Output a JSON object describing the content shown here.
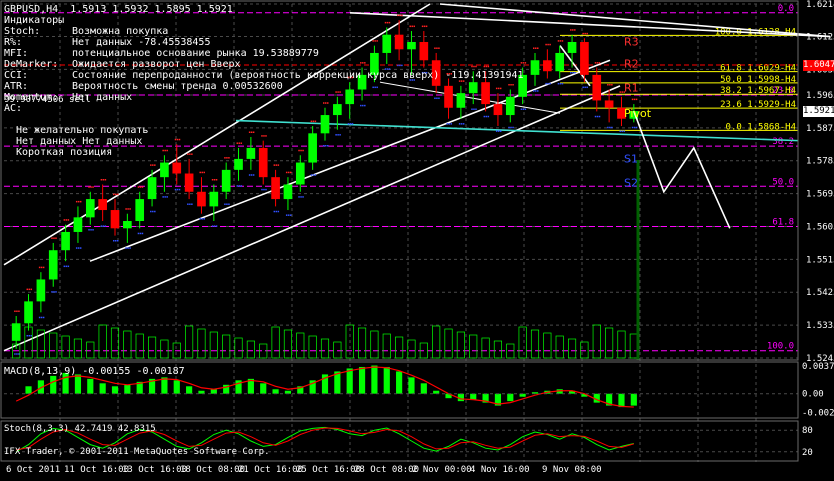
{
  "header": {
    "symbol": "GBPUSD,H4",
    "ohlc": "1.5913 1.5932 1.5895 1.5921"
  },
  "indicators_panel": {
    "title": "Индикаторы",
    "rows": [
      {
        "label": "Stoch:",
        "value": "Возможна покупка"
      },
      {
        "label": "R%:",
        "value": "Нет данных -78.45538455"
      },
      {
        "label": "MFI:",
        "value": "потенциальное основание рынка 19.53889779"
      },
      {
        "label": "DeMarker:",
        "value": "Ожидается разворот цен Вверх"
      },
      {
        "label": "CCI:",
        "value": "Состояние перепроданности (вероятность коррекции курса вверх) -119.41391941"
      },
      {
        "label": "ATR:",
        "value": "Вероятность смены тренда 0.00532600"
      },
      {
        "label": "Momentum:",
        "value": "Нет данных"
      },
      {
        "label": "AC:",
        "value": ""
      }
    ],
    "overlap_text": "99.90774506 sell",
    "signals": [
      "Не желательно покупать",
      "Нет данных Нет данных",
      "Короткая позиция"
    ]
  },
  "colors": {
    "bull": "#00ff00",
    "bear": "#ff0000",
    "grid": "#4a4a4a",
    "fib": "#ff00ff",
    "trend": "#ffffff",
    "cyan": "#40e0d0",
    "dots_red": "#ff2020",
    "dots_blue": "#3050ff",
    "pivot": "#ffff00",
    "macd_signal": "#ff0000",
    "stoch_k": "#00ff00",
    "stoch_d": "#ff0000"
  },
  "chart_data": [
    {
      "type": "candlestick",
      "price_axis": [
        "1.6214",
        "1.6125",
        "1.6035",
        "1.5965",
        "1.5875",
        "1.5785",
        "1.5695",
        "1.5605",
        "1.5515",
        "1.5425",
        "1.5335",
        "1.5245"
      ],
      "ylim": [
        1.5245,
        1.6214
      ],
      "current_price": "1.5921",
      "pivot_price": "1.6047",
      "time_axis": [
        "6 Oct 2011",
        "11 Oct 16:00",
        "13 Oct 16:00",
        "18 Oct 08:00",
        "21 Oct 16:00",
        "25 Oct 16:00",
        "28 Oct 08:00",
        "2 Nov 00:00",
        "4 Nov 16:00",
        "9 Nov 08:00"
      ],
      "candles": [
        [
          1.5292,
          1.536,
          1.527,
          1.534
        ],
        [
          1.534,
          1.542,
          1.532,
          1.54
        ],
        [
          1.54,
          1.548,
          1.537,
          1.546
        ],
        [
          1.546,
          1.556,
          1.544,
          1.554
        ],
        [
          1.554,
          1.561,
          1.551,
          1.559
        ],
        [
          1.559,
          1.566,
          1.556,
          1.563
        ],
        [
          1.563,
          1.57,
          1.561,
          1.568
        ],
        [
          1.568,
          1.572,
          1.562,
          1.565
        ],
        [
          1.565,
          1.568,
          1.558,
          1.56
        ],
        [
          1.56,
          1.564,
          1.556,
          1.562
        ],
        [
          1.562,
          1.57,
          1.56,
          1.568
        ],
        [
          1.568,
          1.576,
          1.566,
          1.574
        ],
        [
          1.574,
          1.58,
          1.57,
          1.578
        ],
        [
          1.578,
          1.583,
          1.572,
          1.575
        ],
        [
          1.575,
          1.579,
          1.568,
          1.57
        ],
        [
          1.57,
          1.574,
          1.564,
          1.566
        ],
        [
          1.566,
          1.572,
          1.562,
          1.57
        ],
        [
          1.57,
          1.578,
          1.568,
          1.576
        ],
        [
          1.576,
          1.582,
          1.573,
          1.579
        ],
        [
          1.579,
          1.585,
          1.576,
          1.582
        ],
        [
          1.582,
          1.584,
          1.572,
          1.574
        ],
        [
          1.574,
          1.576,
          1.566,
          1.568
        ],
        [
          1.568,
          1.574,
          1.565,
          1.572
        ],
        [
          1.572,
          1.58,
          1.57,
          1.578
        ],
        [
          1.578,
          1.588,
          1.576,
          1.586
        ],
        [
          1.586,
          1.593,
          1.584,
          1.591
        ],
        [
          1.591,
          1.596,
          1.587,
          1.594
        ],
        [
          1.594,
          1.6,
          1.59,
          1.598
        ],
        [
          1.598,
          1.604,
          1.595,
          1.602
        ],
        [
          1.602,
          1.61,
          1.6,
          1.608
        ],
        [
          1.608,
          1.615,
          1.605,
          1.613
        ],
        [
          1.613,
          1.617,
          1.606,
          1.609
        ],
        [
          1.609,
          1.614,
          1.602,
          1.611
        ],
        [
          1.611,
          1.614,
          1.604,
          1.606
        ],
        [
          1.606,
          1.608,
          1.597,
          1.599
        ],
        [
          1.599,
          1.601,
          1.59,
          1.593
        ],
        [
          1.593,
          1.599,
          1.59,
          1.597
        ],
        [
          1.597,
          1.603,
          1.594,
          1.6
        ],
        [
          1.6,
          1.603,
          1.592,
          1.594
        ],
        [
          1.594,
          1.597,
          1.588,
          1.591
        ],
        [
          1.591,
          1.598,
          1.589,
          1.596
        ],
        [
          1.596,
          1.604,
          1.594,
          1.602
        ],
        [
          1.602,
          1.608,
          1.599,
          1.606
        ],
        [
          1.606,
          1.609,
          1.601,
          1.603
        ],
        [
          1.603,
          1.61,
          1.601,
          1.608
        ],
        [
          1.608,
          1.613,
          1.604,
          1.611
        ],
        [
          1.611,
          1.612,
          1.6,
          1.602
        ],
        [
          1.602,
          1.604,
          1.592,
          1.595
        ],
        [
          1.595,
          1.598,
          1.589,
          1.593
        ],
        [
          1.593,
          1.596,
          1.588,
          1.59
        ],
        [
          1.59,
          1.594,
          1.589,
          1.5921
        ]
      ],
      "fib_levels_right": [
        {
          "label": "100.0 1.6128-H4",
          "price": 1.6128
        },
        {
          "label": "61.8 1.6029-H4",
          "price": 1.6029
        },
        {
          "label": "50.0 1.5998-H4",
          "price": 1.5998
        },
        {
          "label": "38.2 1.5967-H4",
          "price": 1.5967
        },
        {
          "label": "23.6 1.5929-H4",
          "price": 1.5929
        },
        {
          "label": "0.0 1.5868-H4",
          "price": 1.5868
        }
      ],
      "fib_levels_big": [
        {
          "label": "0.0",
          "price": 1.619
        },
        {
          "label": "23.6",
          "price": 1.5965
        },
        {
          "label": "38.2",
          "price": 1.5825
        },
        {
          "label": "50.0",
          "price": 1.5715
        },
        {
          "label": "61.8",
          "price": 1.5605
        },
        {
          "label": "100.0",
          "price": 1.5265
        }
      ],
      "pivot_labels": [
        {
          "label": "R3",
          "price": 1.61
        },
        {
          "label": "R2",
          "price": 1.604
        },
        {
          "label": "R1",
          "price": 1.5975
        },
        {
          "label": "Pivot",
          "price": 1.5905
        },
        {
          "label": "S1",
          "price": 1.578
        },
        {
          "label": "S2",
          "price": 1.5715
        }
      ],
      "projection": [
        [
          1.5921,
          0.0
        ],
        [
          1.57,
          1.0
        ],
        [
          1.582,
          2.0
        ],
        [
          1.56,
          3.2
        ]
      ]
    },
    {
      "type": "bar",
      "title": "MACD(8,13,9)",
      "values_label": "-0.00155 -0.00187",
      "y_ticks": [
        "0.00376",
        "0.00",
        "-0.00251"
      ],
      "ylim": [
        -0.003,
        0.004
      ],
      "histogram": [
        0.0,
        0.001,
        0.0018,
        0.0024,
        0.0028,
        0.0026,
        0.002,
        0.0014,
        0.001,
        0.0012,
        0.0016,
        0.002,
        0.0022,
        0.0018,
        0.001,
        0.0004,
        0.0006,
        0.0012,
        0.0018,
        0.002,
        0.0014,
        0.0006,
        0.0004,
        0.001,
        0.0018,
        0.0026,
        0.003,
        0.0034,
        0.0036,
        0.0038,
        0.0036,
        0.003,
        0.0022,
        0.0014,
        0.0004,
        -0.0006,
        -0.001,
        -0.0008,
        -0.0012,
        -0.0016,
        -0.001,
        -0.0004,
        0.0002,
        0.0004,
        0.0006,
        0.0004,
        -0.0004,
        -0.0012,
        -0.0016,
        -0.0018,
        -0.0016
      ],
      "signal": [
        -0.001,
        -0.0002,
        0.0008,
        0.0016,
        0.0022,
        0.0024,
        0.0022,
        0.0018,
        0.0014,
        0.0012,
        0.0014,
        0.0017,
        0.002,
        0.0019,
        0.0014,
        0.0008,
        0.0006,
        0.0009,
        0.0014,
        0.0018,
        0.0016,
        0.001,
        0.0006,
        0.0008,
        0.0014,
        0.0021,
        0.0027,
        0.0031,
        0.0034,
        0.0036,
        0.0035,
        0.0031,
        0.0025,
        0.0018,
        0.0009,
        0.0,
        -0.0007,
        -0.0008,
        -0.001,
        -0.0014,
        -0.0012,
        -0.0007,
        -0.0002,
        0.0002,
        0.0004,
        0.0004,
        0.0,
        -0.0008,
        -0.0014,
        -0.0017,
        -0.0018
      ]
    },
    {
      "type": "line",
      "title": "Stoch(8,3,3) 42.7419 42.8315",
      "y_ticks": [
        "80",
        "20"
      ],
      "ylim": [
        0,
        100
      ],
      "k": [
        20,
        40,
        70,
        85,
        80,
        60,
        40,
        30,
        45,
        70,
        82,
        75,
        55,
        35,
        28,
        45,
        68,
        80,
        70,
        50,
        35,
        40,
        60,
        78,
        85,
        88,
        82,
        70,
        65,
        80,
        86,
        70,
        50,
        30,
        22,
        35,
        55,
        45,
        30,
        25,
        40,
        62,
        75,
        68,
        55,
        70,
        60,
        40,
        25,
        35,
        43
      ],
      "d": [
        25,
        32,
        55,
        75,
        82,
        72,
        55,
        40,
        38,
        55,
        72,
        78,
        68,
        50,
        35,
        38,
        55,
        72,
        75,
        62,
        45,
        38,
        50,
        68,
        80,
        86,
        85,
        78,
        70,
        74,
        82,
        78,
        62,
        42,
        28,
        30,
        45,
        48,
        38,
        30,
        33,
        50,
        66,
        70,
        62,
        65,
        63,
        50,
        35,
        32,
        42
      ]
    }
  ],
  "copyright": "IFX Trader, © 2001-2011 MetaQuotes Software Corp."
}
